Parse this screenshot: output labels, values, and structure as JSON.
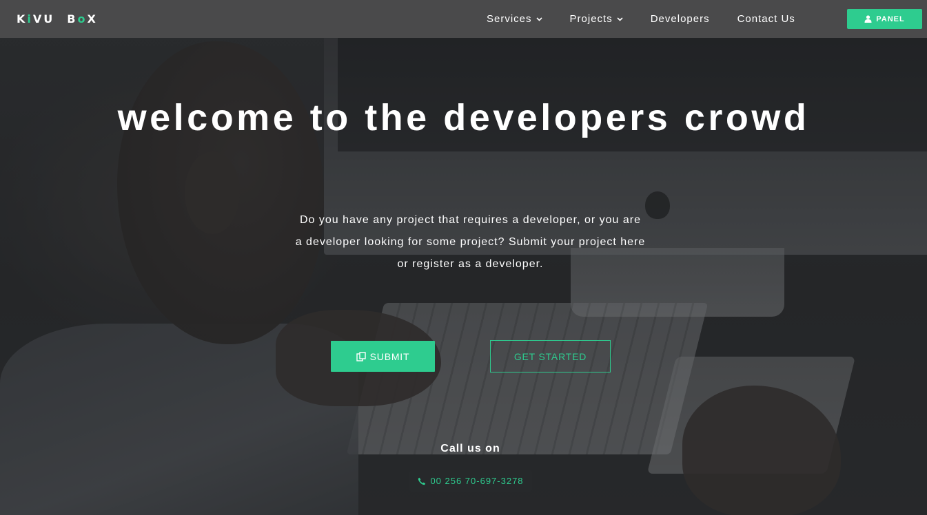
{
  "brand": {
    "letters": [
      "K",
      "i",
      "V",
      "U",
      "B",
      "o",
      "X"
    ],
    "accent_color": "#2ecc8f"
  },
  "nav": {
    "items": [
      {
        "label": "Services",
        "has_dropdown": true
      },
      {
        "label": "Projects",
        "has_dropdown": true
      },
      {
        "label": "Developers",
        "has_dropdown": false
      },
      {
        "label": "Contact Us",
        "has_dropdown": false
      }
    ],
    "caret_glyph": "⌄",
    "panel_button": {
      "label": "PANEL",
      "icon": "user-icon"
    }
  },
  "hero": {
    "title": "welcome to the developers crowd",
    "description_lines": [
      "Do you have any project that requires a developer, or you are",
      "a developer looking for some project? Submit your project here",
      "or register as a developer."
    ],
    "submit_button": {
      "label": "SUBMIT",
      "icon": "document-icon"
    },
    "get_started_button": {
      "label": "GET STARTED"
    }
  },
  "contact": {
    "call_label": "Call us on",
    "phone": "00 256 70-697-3278",
    "icon": "phone-icon"
  },
  "colors": {
    "accent": "#2ecc8f",
    "navbar": "#4a4a4b",
    "text": "#ffffff"
  }
}
